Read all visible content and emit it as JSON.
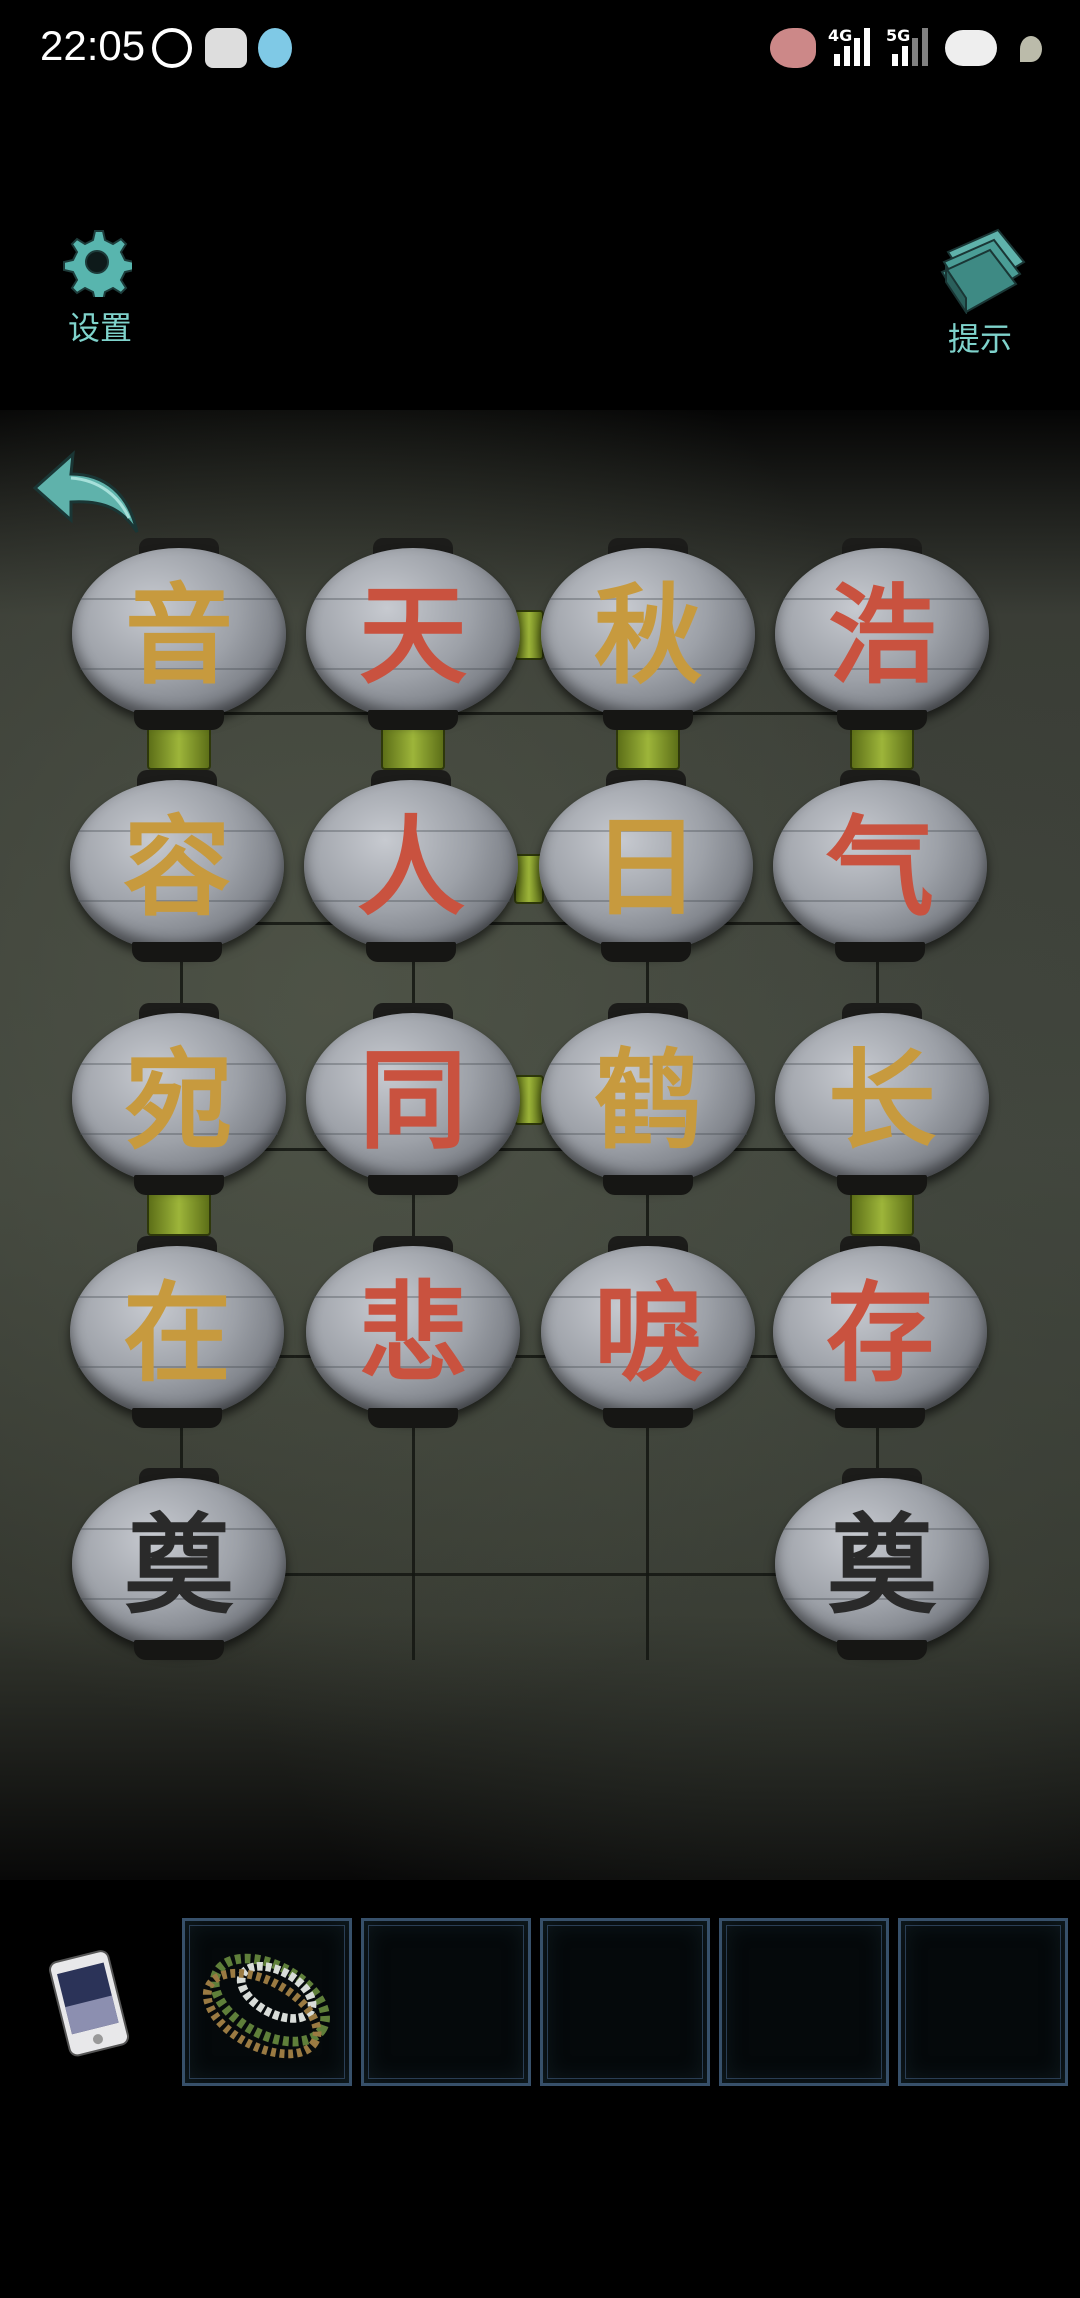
{
  "status_bar": {
    "time": "22:05",
    "icons": [
      "speed-icon",
      "cat-icon",
      "cat-icon",
      "bird-icon",
      "signal-4g-icon",
      "signal-5g-icon",
      "battery-icon",
      "leaf-icon"
    ],
    "signal_4g_label": "4G",
    "signal_5g_label": "5G"
  },
  "toolbar": {
    "settings_label": "设置",
    "hint_label": "提示",
    "settings_icon": "gear-icon",
    "hint_icon": "book-icon",
    "back_icon": "back-arrow-icon"
  },
  "lanterns": [
    {
      "char": "音",
      "color": "gold"
    },
    {
      "char": "天",
      "color": "red"
    },
    {
      "char": "秋",
      "color": "gold"
    },
    {
      "char": "浩",
      "color": "red"
    },
    {
      "char": "容",
      "color": "gold"
    },
    {
      "char": "人",
      "color": "red"
    },
    {
      "char": "日",
      "color": "gold"
    },
    {
      "char": "气",
      "color": "red"
    },
    {
      "char": "宛",
      "color": "gold"
    },
    {
      "char": "同",
      "color": "red"
    },
    {
      "char": "鹤",
      "color": "gold"
    },
    {
      "char": "长",
      "color": "gold"
    },
    {
      "char": "在",
      "color": "gold"
    },
    {
      "char": "悲",
      "color": "red"
    },
    {
      "char": "唳",
      "color": "red"
    },
    {
      "char": "存",
      "color": "red"
    },
    {
      "char": "奠",
      "color": "black"
    },
    {
      "char": "奠",
      "color": "black"
    }
  ],
  "colors": {
    "gold": "#c79a3e",
    "red": "#c9523f",
    "black": "#2a2a2a",
    "accent": "#7fd3cc",
    "connector": "#9db53a"
  },
  "inventory": {
    "phone_icon": "phone-icon",
    "slots": [
      {
        "item": "prayer-beads-icon"
      },
      {
        "item": null
      },
      {
        "item": null
      },
      {
        "item": null
      },
      {
        "item": null
      }
    ]
  }
}
